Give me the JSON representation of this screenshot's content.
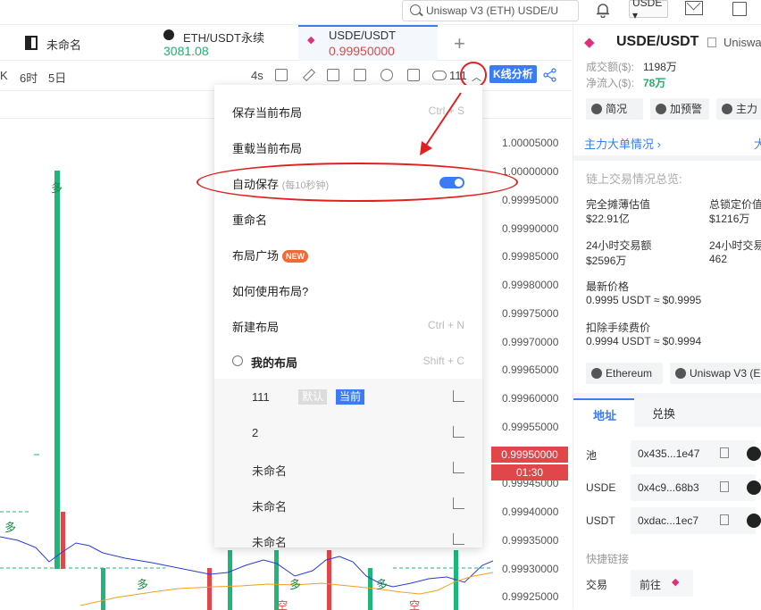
{
  "topbar": {
    "search_text": "Uniswap V3 (ETH) USDE/U",
    "currency": "USDE ▾"
  },
  "tabs": [
    {
      "title": "未命名",
      "price": ""
    },
    {
      "title": "ETH/USDT永续",
      "price": "3081.08"
    },
    {
      "title": "USDE/USDT",
      "price": "0.99950000"
    }
  ],
  "tabs_plus": "+",
  "toolbar": {
    "timeframes": [
      "K",
      "6时",
      "5日"
    ],
    "interval": "4s",
    "layout_count": "111",
    "kline_button": "K线分析"
  },
  "chart": {
    "yaxis_labels": [
      "1.00005000",
      "1.00000000",
      "0.99995000",
      "0.99990000",
      "0.99985000",
      "0.99980000",
      "0.99975000",
      "0.99970000",
      "0.99965000",
      "0.99960000",
      "0.99955000",
      "0.99945000",
      "0.99940000",
      "0.99935000",
      "0.99930000",
      "0.99925000"
    ],
    "price_tag": "0.99950000",
    "time_tag": "01:30",
    "markers": [
      "多",
      "多",
      "多",
      "多",
      "多",
      "空",
      "空"
    ]
  },
  "menu": {
    "save": {
      "label": "保存当前布局",
      "shortcut": "Ctrl + S"
    },
    "reload": {
      "label": "重载当前布局"
    },
    "autosave": {
      "label": "自动保存",
      "hint": "(每10秒钟)"
    },
    "rename": {
      "label": "重命名"
    },
    "plaza": {
      "label": "布局广场",
      "badge": "NEW"
    },
    "howto": {
      "label": "如何使用布局?"
    },
    "new": {
      "label": "新建布局",
      "shortcut": "Ctrl + N"
    },
    "mine": {
      "label": "我的布局",
      "shortcut": "Shift + C"
    },
    "layouts": [
      {
        "name": "111",
        "tag_default": "默认",
        "tag_current": "当前"
      },
      {
        "name": "2"
      },
      {
        "name": "未命名"
      },
      {
        "name": "未命名"
      },
      {
        "name": "未命名"
      }
    ]
  },
  "right": {
    "pair": "USDE/USDT",
    "dex": "Uniswa",
    "volume_label": "成交额($):",
    "volume_value": "1198万",
    "inflow_label": "净流入($):",
    "inflow_value": "78万",
    "btn_brief": "简况",
    "btn_alert": "加预警",
    "btn_main": "主力",
    "whale_link": "主力大单情况",
    "whale_more": "大",
    "overview": "链上交易情况总览:",
    "fdv_label": "完全摊薄估值",
    "fdv_value": "$22.91亿",
    "tvl_label": "总锁定价值",
    "tvl_value": "$1216万",
    "vol24_label": "24小时交易额",
    "vol24_value": "$2596万",
    "tx24_label": "24小时交易",
    "tx24_value": "462",
    "last_label": "最新价格",
    "last_value": "0.9995 USDT ≈ $0.9995",
    "fee_label": "扣除手续费价",
    "fee_value": "0.9994 USDT ≈ $0.9994",
    "chain_chip": "Ethereum",
    "dex_chip": "Uniswap V3 (E",
    "tab_address": "地址",
    "tab_swap": "兑换",
    "addresses": [
      {
        "label": "池",
        "value": "0x435...1e47"
      },
      {
        "label": "USDE",
        "value": "0x4c9...68b3"
      },
      {
        "label": "USDT",
        "value": "0xdac...1ec7"
      }
    ],
    "quick_links": "快捷链接",
    "trade_label": "交易",
    "goto": "前往"
  }
}
